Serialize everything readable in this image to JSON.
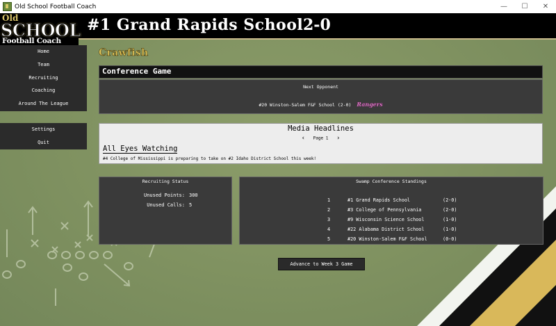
{
  "window": {
    "title": "Old School Football Coach",
    "minimize": "—",
    "maximize": "☐",
    "close": "✕"
  },
  "logo": {
    "line1": "Old",
    "line2": "SCHOOL",
    "line3": "Football Coach"
  },
  "header": {
    "school_title": "#1 Grand Rapids School",
    "record": "2-0"
  },
  "sidebar": {
    "items": [
      {
        "label": "Home"
      },
      {
        "label": "Team"
      },
      {
        "label": "Recruiting"
      },
      {
        "label": "Coaching"
      },
      {
        "label": "Around The League"
      }
    ],
    "secondary": [
      {
        "label": "Settings"
      },
      {
        "label": "Quit"
      }
    ]
  },
  "nickname": "Crawfish",
  "game": {
    "header": "Conference Game",
    "next_label": "Next Opponent",
    "opponent": "#20 Winston-Salem F&F School (2-0)",
    "opponent_logo_text": "Rangers",
    "opponent_logo_color": "#e98ad0"
  },
  "media": {
    "title": "Media Headlines",
    "page_label": "Page 1",
    "prev": "‹",
    "next": "›",
    "headline": "All Eyes Watching",
    "text": "#4 College of Mississippi is preparing to take on #2 Idaho District School this week!"
  },
  "recruiting": {
    "title": "Recruiting Status",
    "points_label": "Unused Points:",
    "points_value": "300",
    "calls_label": "Unused Calls:",
    "calls_value": "5"
  },
  "standings": {
    "title": "Swamp Conference Standings",
    "rows": [
      {
        "rank": "1",
        "team": "#1 Grand Rapids School",
        "record": "(2-0)"
      },
      {
        "rank": "2",
        "team": "#3 College of Pennsylvania",
        "record": "(2-0)"
      },
      {
        "rank": "3",
        "team": "#9 Wisconsin Science School",
        "record": "(1-0)"
      },
      {
        "rank": "4",
        "team": "#22 Alabama District School",
        "record": "(1-0)"
      },
      {
        "rank": "5",
        "team": "#20 Winston-Salem F&F School",
        "record": "(0-0)"
      }
    ]
  },
  "advance_button": "Advance to Week 3 Game",
  "colors": {
    "field": "#7f9160",
    "gold": "#d9b85a",
    "panel": "#3a3a3a",
    "nav": "#2b2b2b"
  }
}
